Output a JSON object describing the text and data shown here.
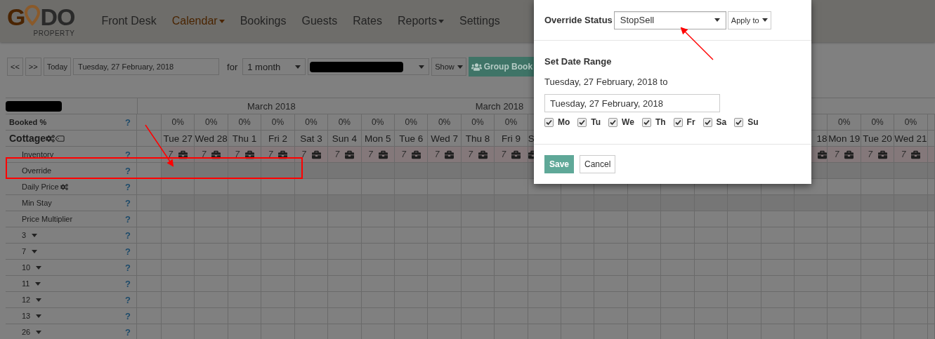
{
  "logo": {
    "lead": "G",
    "tail": "DO",
    "sub": "PROPERTY"
  },
  "nav": [
    {
      "label": "Front Desk",
      "selected": false,
      "dropdown": false
    },
    {
      "label": "Calendar",
      "selected": true,
      "dropdown": true
    },
    {
      "label": "Bookings",
      "selected": false,
      "dropdown": false
    },
    {
      "label": "Guests",
      "selected": false,
      "dropdown": false
    },
    {
      "label": "Rates",
      "selected": false,
      "dropdown": false
    },
    {
      "label": "Reports",
      "selected": false,
      "dropdown": true
    },
    {
      "label": "Settings",
      "selected": false,
      "dropdown": false
    }
  ],
  "toolbar": {
    "prev": "<<",
    "next": ">>",
    "today": "Today",
    "date": "Tuesday, 27 February, 2018",
    "for": "for",
    "period": "1 month",
    "show": "Show",
    "group": "Group Book"
  },
  "calendar": {
    "months": [
      "March 2018",
      "March 2018"
    ],
    "booked": {
      "label": "Booked %",
      "help": "?"
    },
    "room": "Cottage",
    "days_before": [
      {
        "pct": "0%",
        "label": "Tue 27",
        "inventory": "7"
      },
      {
        "pct": "0%",
        "label": "Wed 28",
        "inventory": "7"
      },
      {
        "pct": "0%",
        "label": "Thu 1",
        "inventory": "7"
      },
      {
        "pct": "0%",
        "label": "Fri 2",
        "inventory": "7"
      },
      {
        "pct": "0%",
        "label": "Sat 3",
        "inventory": "7"
      },
      {
        "pct": "0%",
        "label": "Sun 4",
        "inventory": "7"
      },
      {
        "pct": "0%",
        "label": "Mon 5",
        "inventory": "7"
      },
      {
        "pct": "0%",
        "label": "Tue 6",
        "inventory": "7"
      },
      {
        "pct": "0%",
        "label": "Wed 7",
        "inventory": "7"
      },
      {
        "pct": "0%",
        "label": "Thu 8",
        "inventory": "7"
      },
      {
        "pct": "0%",
        "label": "Fri 9",
        "inventory": "7"
      },
      {
        "label": "S"
      }
    ],
    "days_after": [
      {
        "label": "18"
      },
      {
        "pct": "0%",
        "label": "Mon 19",
        "inventory": "7"
      },
      {
        "pct": "0%",
        "label": "Tue 20",
        "inventory": "7"
      },
      {
        "pct": "0%",
        "label": "Wed 21",
        "inventory": "7"
      }
    ],
    "rows": [
      {
        "label": "Inventory",
        "kind": "inventory",
        "help": "?"
      },
      {
        "label": "Override",
        "kind": "override",
        "help": "?"
      },
      {
        "label": "Daily Price",
        "kind": "price",
        "help": "?"
      },
      {
        "label": "Min Stay",
        "kind": "minstay",
        "help": "?"
      },
      {
        "label": "Price Multiplier",
        "kind": "plain",
        "help": "?"
      },
      {
        "label": "3",
        "kind": "unit",
        "help": "?"
      },
      {
        "label": "7",
        "kind": "unit",
        "help": "?"
      },
      {
        "label": "10",
        "kind": "unit",
        "help": "?"
      },
      {
        "label": "11",
        "kind": "unit",
        "help": "?"
      },
      {
        "label": "12",
        "kind": "unit",
        "help": "?"
      },
      {
        "label": "13",
        "kind": "unit",
        "help": "?"
      },
      {
        "label": "26",
        "kind": "unit",
        "help": "?"
      }
    ]
  },
  "modal": {
    "status_label": "Override Status",
    "status": "StopSell",
    "apply": "Apply to",
    "range_title": "Set Date Range",
    "from": "Tuesday, 27 February, 2018 to",
    "to": "Tuesday, 27 February, 2018",
    "weekdays": [
      {
        "label": "Mo",
        "checked": true
      },
      {
        "label": "Tu",
        "checked": true
      },
      {
        "label": "We",
        "checked": true
      },
      {
        "label": "Th",
        "checked": true
      },
      {
        "label": "Fr",
        "checked": true
      },
      {
        "label": "Sa",
        "checked": true
      },
      {
        "label": "Su",
        "checked": true
      }
    ],
    "save": "Save",
    "cancel": "Cancel"
  }
}
